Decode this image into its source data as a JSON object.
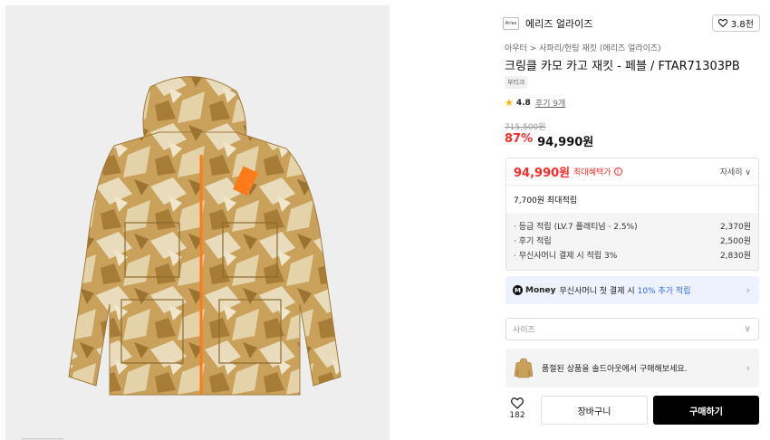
{
  "brand": {
    "logo_text": "Aries",
    "name": "에리즈 얼라이즈",
    "likes": "3.8천"
  },
  "breadcrumb": {
    "category": "아우터",
    "separator": ">",
    "subcategory": "사파리/헌팅 재킷 (에리즈 얼라이즈)"
  },
  "product": {
    "title": "크링클 카모 카고 재킷 - 페블 / FTAR71303PB",
    "tag": "부티크",
    "rating": "4.8",
    "reviews": "후기 9개",
    "original_price": "715,500원",
    "discount": "87%",
    "price": "94,990원"
  },
  "benefit": {
    "price": "94,990원",
    "label": "최대혜택가",
    "info_icon": "i",
    "detail": "자세히 ∨",
    "points_title": "7,700원 최대적립",
    "points": [
      {
        "label": "· 등급 적립 (LV.7 플래티넘 · 2.5%)",
        "value": "2,370원"
      },
      {
        "label": "· 후기 적립",
        "value": "2,500원"
      },
      {
        "label": "· 무신사머니 결제 시 적립 3%",
        "value": "2,830원"
      }
    ]
  },
  "money_banner": {
    "icon": "M",
    "brand": "Money",
    "text_before": "무신사머니 첫 결제 시",
    "highlight": "10% 추가 적립",
    "chevron": "›"
  },
  "size_select": {
    "placeholder": "사이즈",
    "chevron": "∨"
  },
  "soldout_banner": {
    "text": "품절된 상품을 솔드아웃에서 구매해보세요.",
    "chevron": "›"
  },
  "actions": {
    "wish_count": "182",
    "cart_label": "장바구니",
    "buy_label": "구매하기"
  },
  "colors": {
    "accent_red": "#ff2b2b",
    "money_blue": "#2f6bff",
    "star": "#ffb400",
    "jacket_base": "#c9a15b",
    "zipper": "#ff7a1a"
  }
}
